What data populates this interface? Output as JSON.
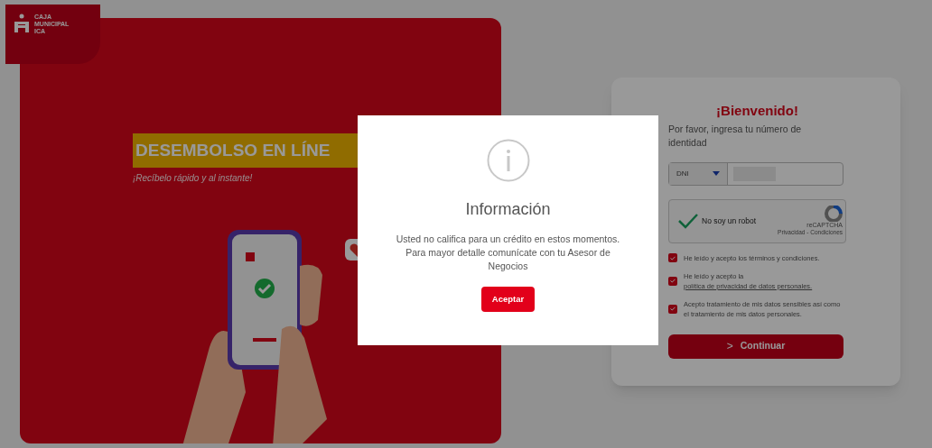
{
  "logo": {
    "lines": [
      "CAJA",
      "MUNICIPAL",
      "ICA"
    ]
  },
  "banner": {
    "headline": "DESEMBOLSO EN LÍNE",
    "subtitle": "¡Recíbelo rápido y al instante!"
  },
  "login": {
    "title": "¡Bienvenido!",
    "instruction": "Por favor, ingresa tu número de identidad",
    "document_type": "DNI",
    "captcha": {
      "checked": true,
      "label": "No soy un robot",
      "brand": "reCAPTCHA",
      "links": "Privacidad - Condiciones"
    },
    "consents": [
      {
        "text": "He leído y acepto los términos y condiciones.",
        "checked": true
      },
      {
        "text": "He leído y acepto la ",
        "link": "política de privacidad de datos personales.",
        "checked": true
      },
      {
        "text": "Acepto tratamiento de mis datos sensibles así como el tratamiento de mis datos personales.",
        "checked": true
      }
    ],
    "submit": {
      "icon": ">",
      "label": "Continuar"
    }
  },
  "dialog": {
    "title": "Información",
    "message": "Usted no califica para un crédito en estos momentos. Para mayor detalle comunícate con tu Asesor de Negocios",
    "button": "Aceptar"
  }
}
